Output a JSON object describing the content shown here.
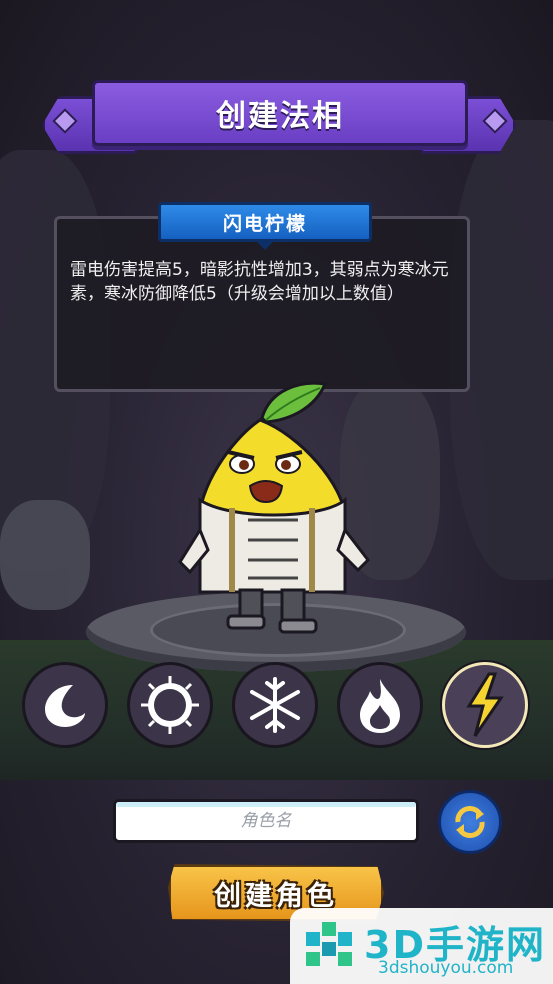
{
  "header": {
    "title": "创建法相"
  },
  "class_card": {
    "name": "闪电柠檬",
    "description": "雷电伤害提高5，暗影抗性增加3，其弱点为寒冰元素，寒冰防御降低5（升级会增加以上数值）"
  },
  "elements": [
    {
      "name": "moon-icon",
      "selected": false
    },
    {
      "name": "sun-icon",
      "selected": false
    },
    {
      "name": "snowflake-icon",
      "selected": false
    },
    {
      "name": "flame-icon",
      "selected": false
    },
    {
      "name": "lightning-icon",
      "selected": true
    }
  ],
  "name_field": {
    "value": "",
    "placeholder": "角色名"
  },
  "create_button": {
    "label": "创建角色"
  },
  "watermark": {
    "brand": "3D手游网",
    "url": "3dshouyou.com"
  },
  "colors": {
    "banner_purple": "#7b4fd6",
    "tab_blue": "#1f74d6",
    "button_orange": "#f0a830",
    "watermark_teal": "#1fb4c8"
  }
}
